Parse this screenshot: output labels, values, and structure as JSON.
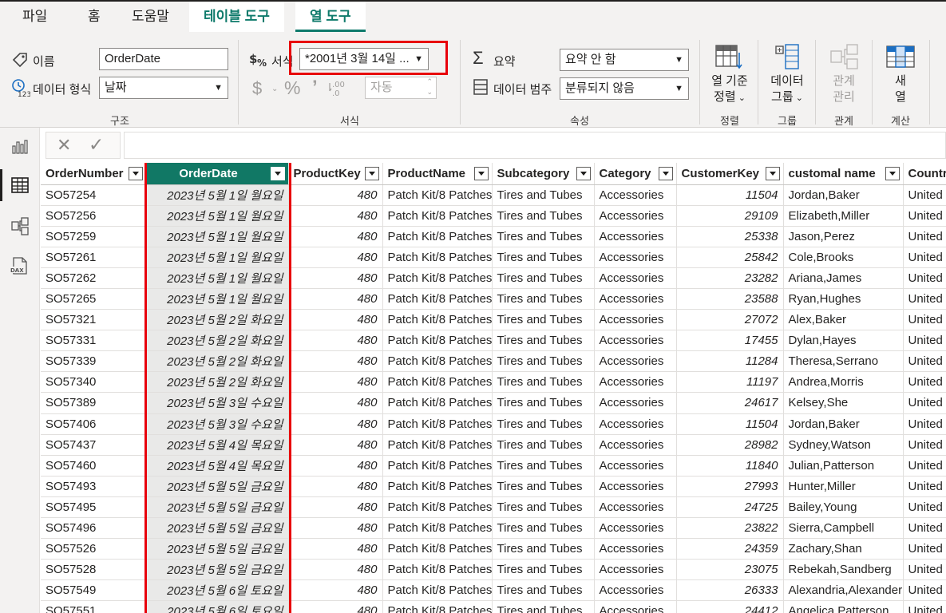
{
  "tabs": [
    {
      "label": "파일"
    },
    {
      "label": "홈"
    },
    {
      "label": "도움말"
    },
    {
      "label": "테이블 도구"
    },
    {
      "label": "열 도구"
    }
  ],
  "ribbon": {
    "structure": {
      "name_label": "이름",
      "name_value": "OrderDate",
      "datatype_label": "데이터 형식",
      "datatype_value": "날짜",
      "group_label": "구조"
    },
    "format": {
      "format_label": "서식",
      "format_value": "*2001년 3월 14일 ...",
      "auto_value": "자동",
      "group_label": "서식"
    },
    "properties": {
      "summary_label": "요약",
      "summary_value": "요약 안 함",
      "category_label": "데이터 범주",
      "category_value": "분류되지 않음",
      "group_label": "속성"
    },
    "sort": {
      "line1": "열 기준",
      "line2": "정렬",
      "group_label": "정렬"
    },
    "group": {
      "line1": "데이터",
      "line2": "그룹",
      "group_label": "그룹"
    },
    "relations": {
      "line1": "관계",
      "line2": "관리",
      "group_label": "관계"
    },
    "calc": {
      "line1": "새",
      "line2": "열",
      "group_label": "계산"
    }
  },
  "table": {
    "columns": [
      "OrderNumber",
      "OrderDate",
      "ProductKey",
      "ProductName",
      "Subcategory",
      "Category",
      "CustomerKey",
      "customal name",
      "Country"
    ],
    "rows": [
      [
        "SO57254",
        "2023년 5월 1일 월요일",
        "480",
        "Patch Kit/8 Patches",
        "Tires and Tubes",
        "Accessories",
        "11504",
        "Jordan,Baker",
        "United S"
      ],
      [
        "SO57256",
        "2023년 5월 1일 월요일",
        "480",
        "Patch Kit/8 Patches",
        "Tires and Tubes",
        "Accessories",
        "29109",
        "Elizabeth,Miller",
        "United S"
      ],
      [
        "SO57259",
        "2023년 5월 1일 월요일",
        "480",
        "Patch Kit/8 Patches",
        "Tires and Tubes",
        "Accessories",
        "25338",
        "Jason,Perez",
        "United S"
      ],
      [
        "SO57261",
        "2023년 5월 1일 월요일",
        "480",
        "Patch Kit/8 Patches",
        "Tires and Tubes",
        "Accessories",
        "25842",
        "Cole,Brooks",
        "United S"
      ],
      [
        "SO57262",
        "2023년 5월 1일 월요일",
        "480",
        "Patch Kit/8 Patches",
        "Tires and Tubes",
        "Accessories",
        "23282",
        "Ariana,James",
        "United S"
      ],
      [
        "SO57265",
        "2023년 5월 1일 월요일",
        "480",
        "Patch Kit/8 Patches",
        "Tires and Tubes",
        "Accessories",
        "23588",
        "Ryan,Hughes",
        "United S"
      ],
      [
        "SO57321",
        "2023년 5월 2일 화요일",
        "480",
        "Patch Kit/8 Patches",
        "Tires and Tubes",
        "Accessories",
        "27072",
        "Alex,Baker",
        "United S"
      ],
      [
        "SO57331",
        "2023년 5월 2일 화요일",
        "480",
        "Patch Kit/8 Patches",
        "Tires and Tubes",
        "Accessories",
        "17455",
        "Dylan,Hayes",
        "United S"
      ],
      [
        "SO57339",
        "2023년 5월 2일 화요일",
        "480",
        "Patch Kit/8 Patches",
        "Tires and Tubes",
        "Accessories",
        "11284",
        "Theresa,Serrano",
        "United S"
      ],
      [
        "SO57340",
        "2023년 5월 2일 화요일",
        "480",
        "Patch Kit/8 Patches",
        "Tires and Tubes",
        "Accessories",
        "11197",
        "Andrea,Morris",
        "United S"
      ],
      [
        "SO57389",
        "2023년 5월 3일 수요일",
        "480",
        "Patch Kit/8 Patches",
        "Tires and Tubes",
        "Accessories",
        "24617",
        "Kelsey,She",
        "United S"
      ],
      [
        "SO57406",
        "2023년 5월 3일 수요일",
        "480",
        "Patch Kit/8 Patches",
        "Tires and Tubes",
        "Accessories",
        "11504",
        "Jordan,Baker",
        "United S"
      ],
      [
        "SO57437",
        "2023년 5월 4일 목요일",
        "480",
        "Patch Kit/8 Patches",
        "Tires and Tubes",
        "Accessories",
        "28982",
        "Sydney,Watson",
        "United S"
      ],
      [
        "SO57460",
        "2023년 5월 4일 목요일",
        "480",
        "Patch Kit/8 Patches",
        "Tires and Tubes",
        "Accessories",
        "11840",
        "Julian,Patterson",
        "United S"
      ],
      [
        "SO57493",
        "2023년 5월 5일 금요일",
        "480",
        "Patch Kit/8 Patches",
        "Tires and Tubes",
        "Accessories",
        "27993",
        "Hunter,Miller",
        "United S"
      ],
      [
        "SO57495",
        "2023년 5월 5일 금요일",
        "480",
        "Patch Kit/8 Patches",
        "Tires and Tubes",
        "Accessories",
        "24725",
        "Bailey,Young",
        "United S"
      ],
      [
        "SO57496",
        "2023년 5월 5일 금요일",
        "480",
        "Patch Kit/8 Patches",
        "Tires and Tubes",
        "Accessories",
        "23822",
        "Sierra,Campbell",
        "United S"
      ],
      [
        "SO57526",
        "2023년 5월 5일 금요일",
        "480",
        "Patch Kit/8 Patches",
        "Tires and Tubes",
        "Accessories",
        "24359",
        "Zachary,Shan",
        "United S"
      ],
      [
        "SO57528",
        "2023년 5월 5일 금요일",
        "480",
        "Patch Kit/8 Patches",
        "Tires and Tubes",
        "Accessories",
        "23075",
        "Rebekah,Sandberg",
        "United S"
      ],
      [
        "SO57549",
        "2023년 5월 6일 토요일",
        "480",
        "Patch Kit/8 Patches",
        "Tires and Tubes",
        "Accessories",
        "26333",
        "Alexandria,Alexander",
        "United S"
      ],
      [
        "SO57551",
        "2023년 5월 6일 토요일",
        "480",
        "Patch Kit/8 Patches",
        "Tires and Tubes",
        "Accessories",
        "24412",
        "Angelica,Patterson",
        "United S"
      ]
    ]
  },
  "colors": {
    "accent": "#117865",
    "context_tab": "#0e7a6b",
    "highlight_box": "#e8000b"
  }
}
